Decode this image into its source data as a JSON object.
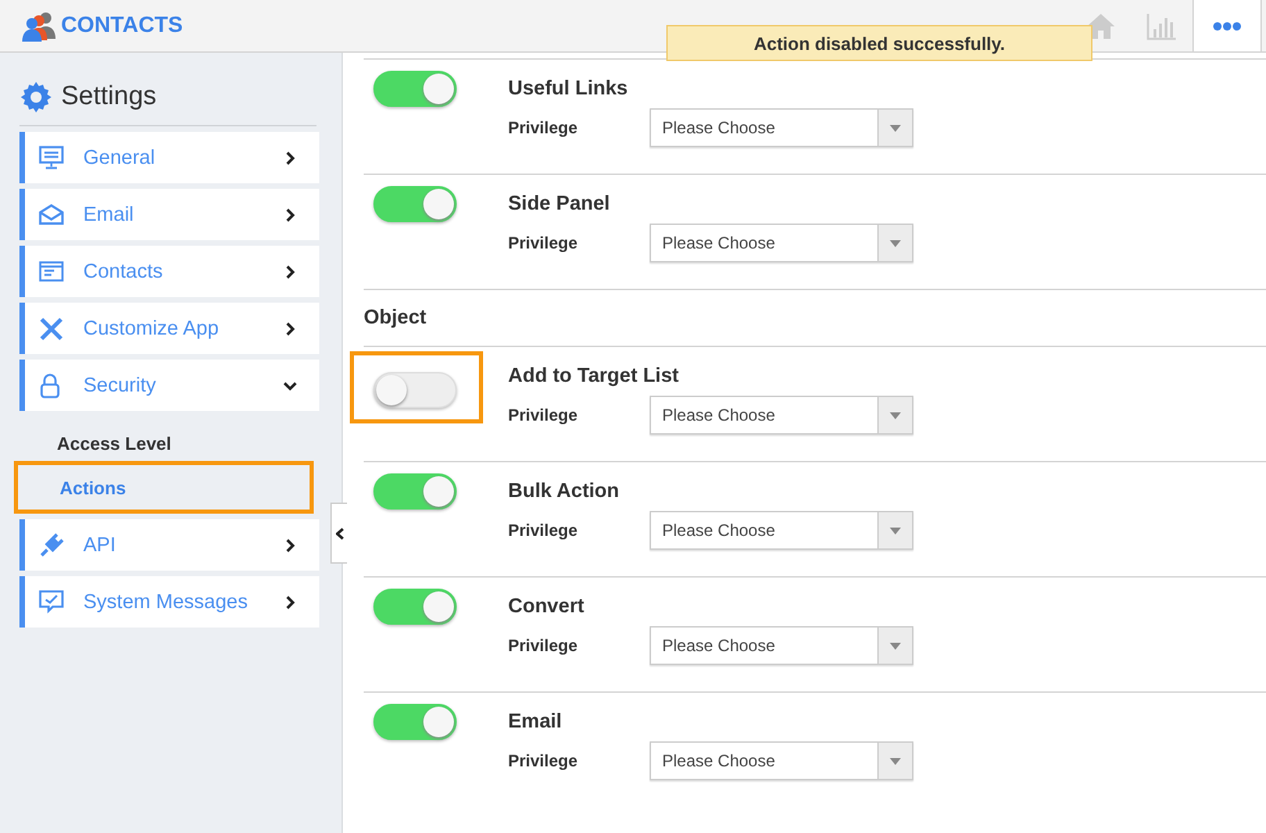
{
  "header": {
    "app_title": "CONTACTS",
    "toast": "Action disabled successfully."
  },
  "sidebar": {
    "title": "Settings",
    "items": [
      {
        "label": "General",
        "expanded": false
      },
      {
        "label": "Email",
        "expanded": false
      },
      {
        "label": "Contacts",
        "expanded": false
      },
      {
        "label": "Customize App",
        "expanded": false
      },
      {
        "label": "Security",
        "expanded": true,
        "children": [
          {
            "label": "Access Level",
            "selected": false,
            "highlighted": false
          },
          {
            "label": "Actions",
            "selected": true,
            "highlighted": true
          }
        ]
      },
      {
        "label": "API",
        "expanded": false
      },
      {
        "label": "System Messages",
        "expanded": false
      }
    ]
  },
  "sections": [
    {
      "actions": [
        {
          "name": "Useful Links",
          "on": true,
          "highlighted": false,
          "privilege_label": "Privilege",
          "placeholder": "Please Choose"
        },
        {
          "name": "Side Panel",
          "on": true,
          "highlighted": false,
          "privilege_label": "Privilege",
          "placeholder": "Please Choose"
        }
      ]
    },
    {
      "title": "Object",
      "actions": [
        {
          "name": "Add to Target List",
          "on": false,
          "highlighted": true,
          "privilege_label": "Privilege",
          "placeholder": "Please Choose"
        },
        {
          "name": "Bulk Action",
          "on": true,
          "highlighted": false,
          "privilege_label": "Privilege",
          "placeholder": "Please Choose"
        },
        {
          "name": "Convert",
          "on": true,
          "highlighted": false,
          "privilege_label": "Privilege",
          "placeholder": "Please Choose"
        },
        {
          "name": "Email",
          "on": true,
          "highlighted": false,
          "privilege_label": "Privilege",
          "placeholder": "Please Choose"
        }
      ]
    }
  ]
}
